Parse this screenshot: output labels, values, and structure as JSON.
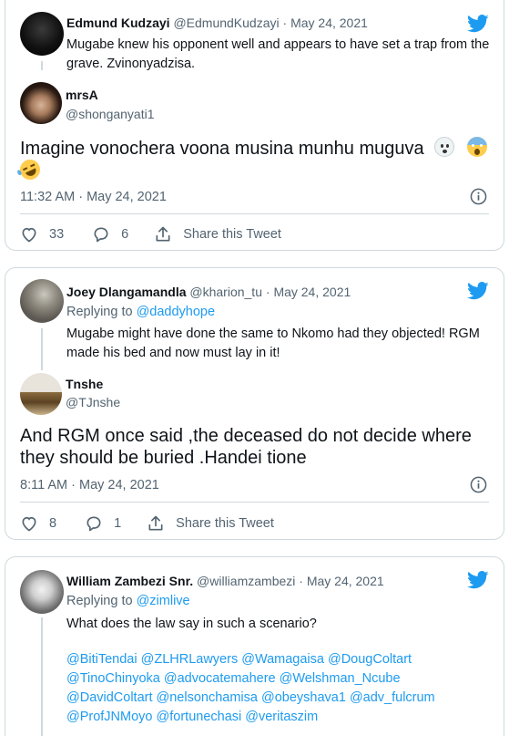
{
  "tweets": [
    {
      "author_name": "Edmund Kudzayi",
      "author_handle": "@EdmundKudzayi",
      "separator": "·",
      "date": "May 24, 2021",
      "text": "Mugabe knew his opponent well and appears to have set a trap from the grave. Zvinonyadzisa.",
      "quoted": {
        "author_name": "mrsA",
        "author_handle": "@shonganyati1",
        "text": "Imagine vonochera voona musina munhu muguva",
        "emojis": [
          "ghost",
          "scream",
          "rofl"
        ]
      },
      "timestamp": "11:32 AM · May 24, 2021",
      "likes": "33",
      "replies": "6",
      "share_label": "Share this Tweet"
    },
    {
      "author_name": "Joey Dlangamandla",
      "author_handle": "@kharion_tu",
      "separator": "·",
      "date": "May 24, 2021",
      "replying_prefix": "Replying to",
      "replying_to": "@daddyhope",
      "text": "Mugabe might have done the same to Nkomo had they objected! RGM made his bed and now must lay in it!",
      "quoted": {
        "author_name": "Tnshe",
        "author_handle": "@TJnshe",
        "text": "And RGM once said ,the deceased do not decide where they should be buried .Handei tione"
      },
      "timestamp": "8:11 AM · May 24, 2021",
      "likes": "8",
      "replies": "1",
      "share_label": "Share this Tweet"
    },
    {
      "author_name": "William Zambezi Snr.",
      "author_handle": "@williamzambezi",
      "separator": "·",
      "date": "May 24, 2021",
      "replying_prefix": "Replying to",
      "replying_to": "@zimlive",
      "text": "What does the law say in such a scenario?",
      "mentions": [
        "@BitiTendai @ZLHRLawyers @Wamagaisa @DougColtart",
        "@TinoChinyoka @advocatemahere @Welshman_Ncube",
        "@DavidColtart @nelsonchamisa @obeyshava1 @adv_fulcrum",
        "@ProfJNMoyo @fortunechasi @veritaszim"
      ]
    }
  ],
  "colors": {
    "twitter_blue": "#1d9bf0",
    "secondary_text": "#536471",
    "border": "#cfd9de"
  },
  "icons": [
    "twitter-bird-icon",
    "info-icon",
    "heart-icon",
    "reply-bubble-icon",
    "share-icon"
  ]
}
